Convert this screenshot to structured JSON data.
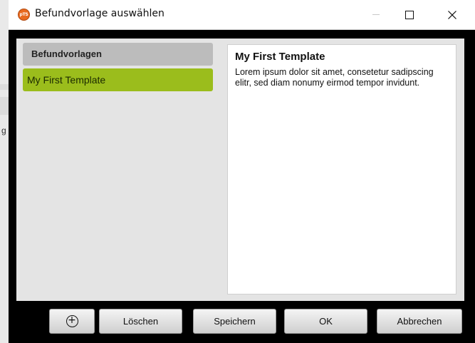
{
  "background": {
    "side_letter": "g"
  },
  "window": {
    "title": "Befundvorlage auswählen",
    "icon_text": "pTS"
  },
  "template_list": {
    "header": "Befundvorlagen",
    "items": [
      {
        "label": "My First Template",
        "selected": true
      }
    ]
  },
  "preview": {
    "title": "My First Template",
    "body": "Lorem ipsum dolor sit amet, consetetur sadipscing elitr, sed diam nonumy eirmod tempor invidunt."
  },
  "toolbar": {
    "add_icon": "plus-circle-icon",
    "delete_label": "Löschen",
    "save_label": "Speichern",
    "ok_label": "OK",
    "cancel_label": "Abbrechen"
  },
  "colors": {
    "accent": "#9bbd1c",
    "icon_orange": "#e86a1f"
  }
}
